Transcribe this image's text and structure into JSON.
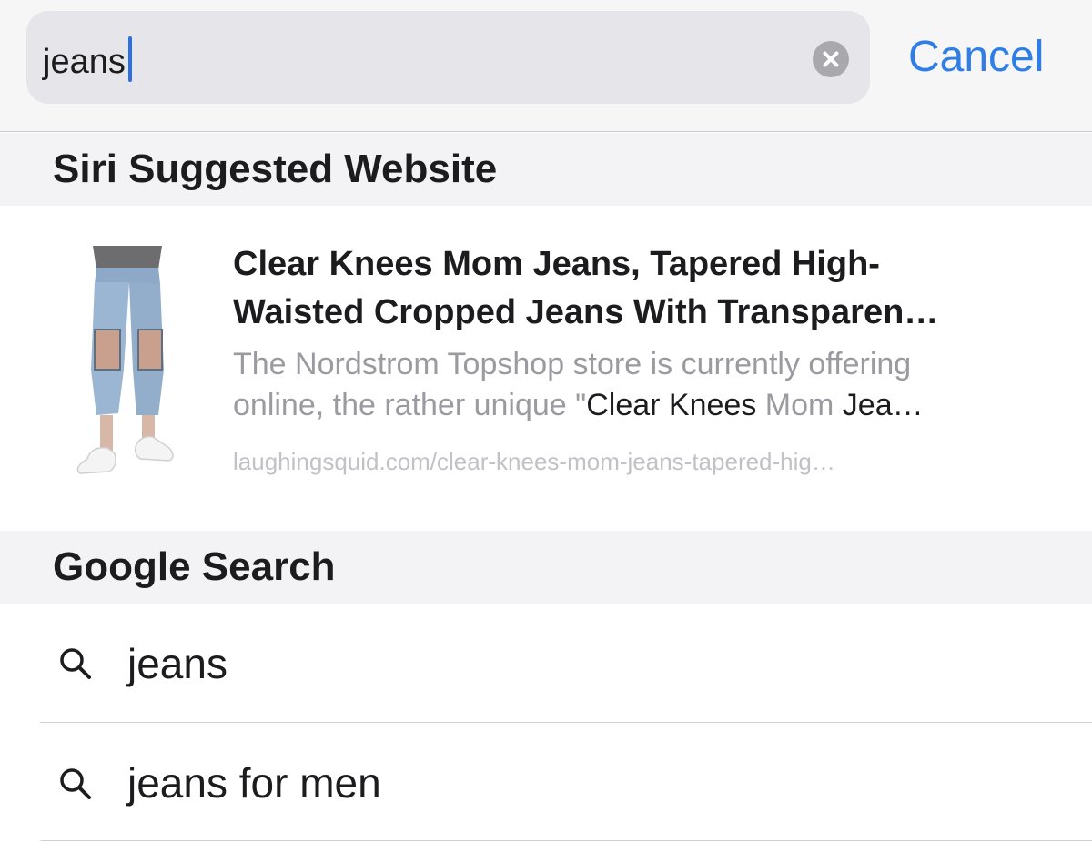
{
  "search": {
    "query": "jeans",
    "clear_icon": "clear-x-circle-icon",
    "cancel_label": "Cancel"
  },
  "siri_section": {
    "header": "Siri Suggested Website",
    "result": {
      "title_line1": "Clear Knees Mom Jeans, Tapered High-",
      "title_line2": "Waisted Cropped Jeans With Transparen…",
      "snippet_line1": "The Nordstrom Topshop store is currently offering",
      "snippet_line2_plain": "online, the rather unique \"",
      "snippet_line2_hl1": "Clear Knees",
      "snippet_line2_mid": " Mom ",
      "snippet_line2_hl2": "Jea…",
      "url": "laughingsquid.com/clear-knees-mom-jeans-tapered-hig…"
    }
  },
  "google_section": {
    "header": "Google Search",
    "suggestions": [
      {
        "text": "jeans",
        "icon": "search-icon"
      },
      {
        "text": "jeans for men",
        "icon": "search-icon"
      }
    ]
  },
  "colors": {
    "accent": "#2f7ee6",
    "caret": "#2e6fe0",
    "secondary_text": "#9a9aa0",
    "url_text": "#c1c1c6",
    "section_bg": "#f3f3f5"
  }
}
